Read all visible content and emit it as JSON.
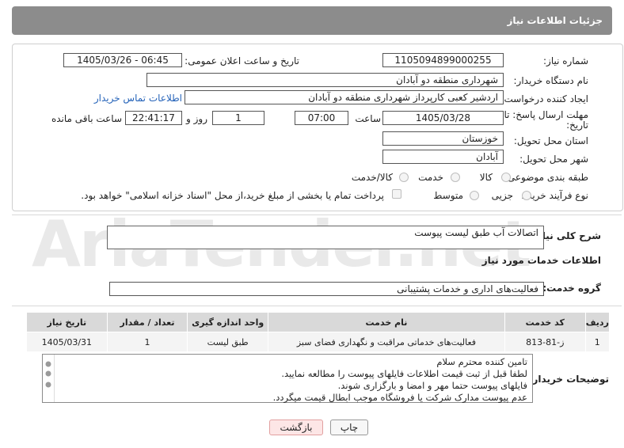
{
  "header": {
    "title": "جزئیات اطلاعات نیاز"
  },
  "form": {
    "need_number_label": "شماره نیاز:",
    "need_number": "1105094899000255",
    "announce_label": "تاریخ و ساعت اعلان عمومی:",
    "announce_value": "1405/03/26 - 06:45",
    "buyer_org_label": "نام دستگاه خریدار:",
    "buyer_org": "شهرداری منطقه دو آبادان",
    "creator_label": "ایجاد کننده درخواست:",
    "creator": "اردشیر کعبی کارپرداز شهرداری منطقه دو آبادان",
    "contact_link": "اطلاعات تماس خریدار",
    "deadline_label_1": "مهلت ارسال پاسخ: تا",
    "deadline_label_2": "تاریخ:",
    "deadline_date": "1405/03/28",
    "hour_label": "ساعت",
    "deadline_time": "07:00",
    "days_value": "1",
    "days_label": "روز و",
    "remaining_time": "22:41:17",
    "remaining_label": "ساعت باقی مانده",
    "province_label": "استان محل تحویل:",
    "province": "خوزستان",
    "city_label": "شهر محل تحویل:",
    "city": "آبادان",
    "category_label": "طبقه بندی موضوعی:",
    "category_options": [
      "کالا",
      "خدمت",
      "کالا/خدمت"
    ],
    "purchase_type_label": "نوع فرآیند خرید :",
    "purchase_options": [
      "جزیی",
      "متوسط"
    ],
    "payment_note": "پرداخت تمام یا بخشی از مبلغ خرید،از محل \"اسناد خزانه اسلامی\" خواهد بود."
  },
  "summary": {
    "label": "شرح کلی نیاز:",
    "value": "اتصالات آب طبق لیست پیوست"
  },
  "services": {
    "title": "اطلاعات خدمات مورد نیاز",
    "group_label": "گروه خدمت:",
    "group_value": "فعالیت‌های اداری و خدمات پشتیبانی"
  },
  "table": {
    "headers": [
      "ردیف",
      "کد خدمت",
      "نام خدمت",
      "واحد اندازه گیری",
      "تعداد / مقدار",
      "تاریخ نیاز"
    ],
    "rows": [
      [
        "1",
        "ز-81-813",
        "فعالیت‌های خدماتی مراقبت و نگهداری فضای سبز",
        "طبق لیست",
        "1",
        "1405/03/31"
      ]
    ]
  },
  "notes": {
    "label": "توضیحات خریدار:",
    "lines": [
      "تامین کننده محترم سلام",
      "لطفا قبل از ثبت قیمت اطلاعات فایلهای پیوست را مطالعه نمایید.",
      "فایلهای پیوست حتما مهر و امضا و بارگزاری شوند.",
      "عدم پیوست مدارک شرکت یا فروشگاه موجب ابطال قیمت میگردد."
    ]
  },
  "buttons": {
    "print": "چاپ",
    "back": "بازگشت"
  },
  "watermark": "AriaTender.net"
}
